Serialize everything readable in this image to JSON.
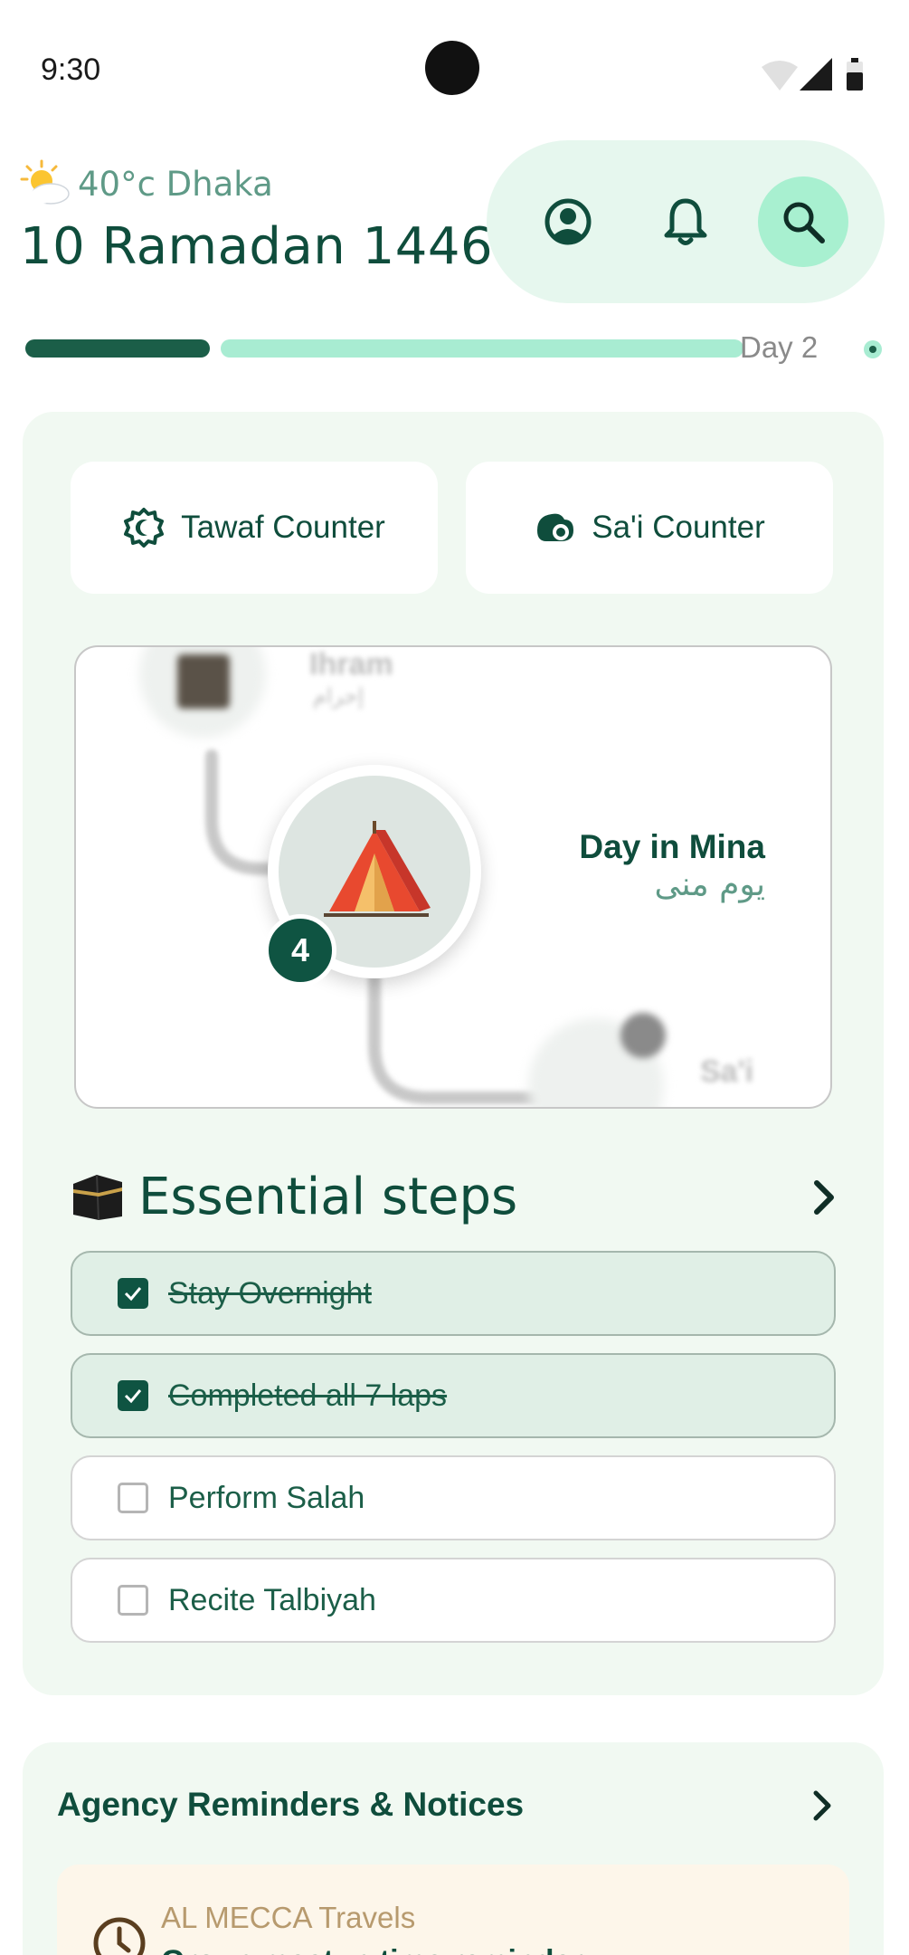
{
  "status_bar": {
    "time": "9:30"
  },
  "header": {
    "weather": "40°c Dhaka",
    "weather_icon": "sun-behind-cloud-icon",
    "date": "10 Ramadan 1446",
    "actions": [
      {
        "name": "profile",
        "icon": "profile-icon"
      },
      {
        "name": "notifications",
        "icon": "bell-icon"
      },
      {
        "name": "search",
        "icon": "search-icon"
      }
    ]
  },
  "progress": {
    "day_label": "Day 2",
    "completed_fraction": 0.22
  },
  "counters": {
    "tawaf_label": "Tawaf Counter",
    "sai_label": "Sa'i Counter"
  },
  "journey": {
    "prev_step_label": "Ihram",
    "prev_step_ar": "إحرام",
    "current_step_number": "4",
    "current_step_title": "Day in Mina",
    "current_step_ar": "يوم منى",
    "next_step_label": "Sa'i"
  },
  "essentials": {
    "title": "Essential steps",
    "tasks": [
      {
        "label": "Stay Overnight",
        "done": true
      },
      {
        "label": "Completed all 7 laps",
        "done": true
      },
      {
        "label": "Perform Salah",
        "done": false
      },
      {
        "label": "Recite Talbiyah",
        "done": false
      }
    ]
  },
  "agency": {
    "title": "Agency Reminders & Notices",
    "notice_agency": "AL MECCA Travels",
    "notice_text": "Group meetup time reminder"
  },
  "colors": {
    "primary": "#0f4d3c",
    "accent_mint": "#a8f0d0",
    "card_bg": "#f1f9f2"
  }
}
